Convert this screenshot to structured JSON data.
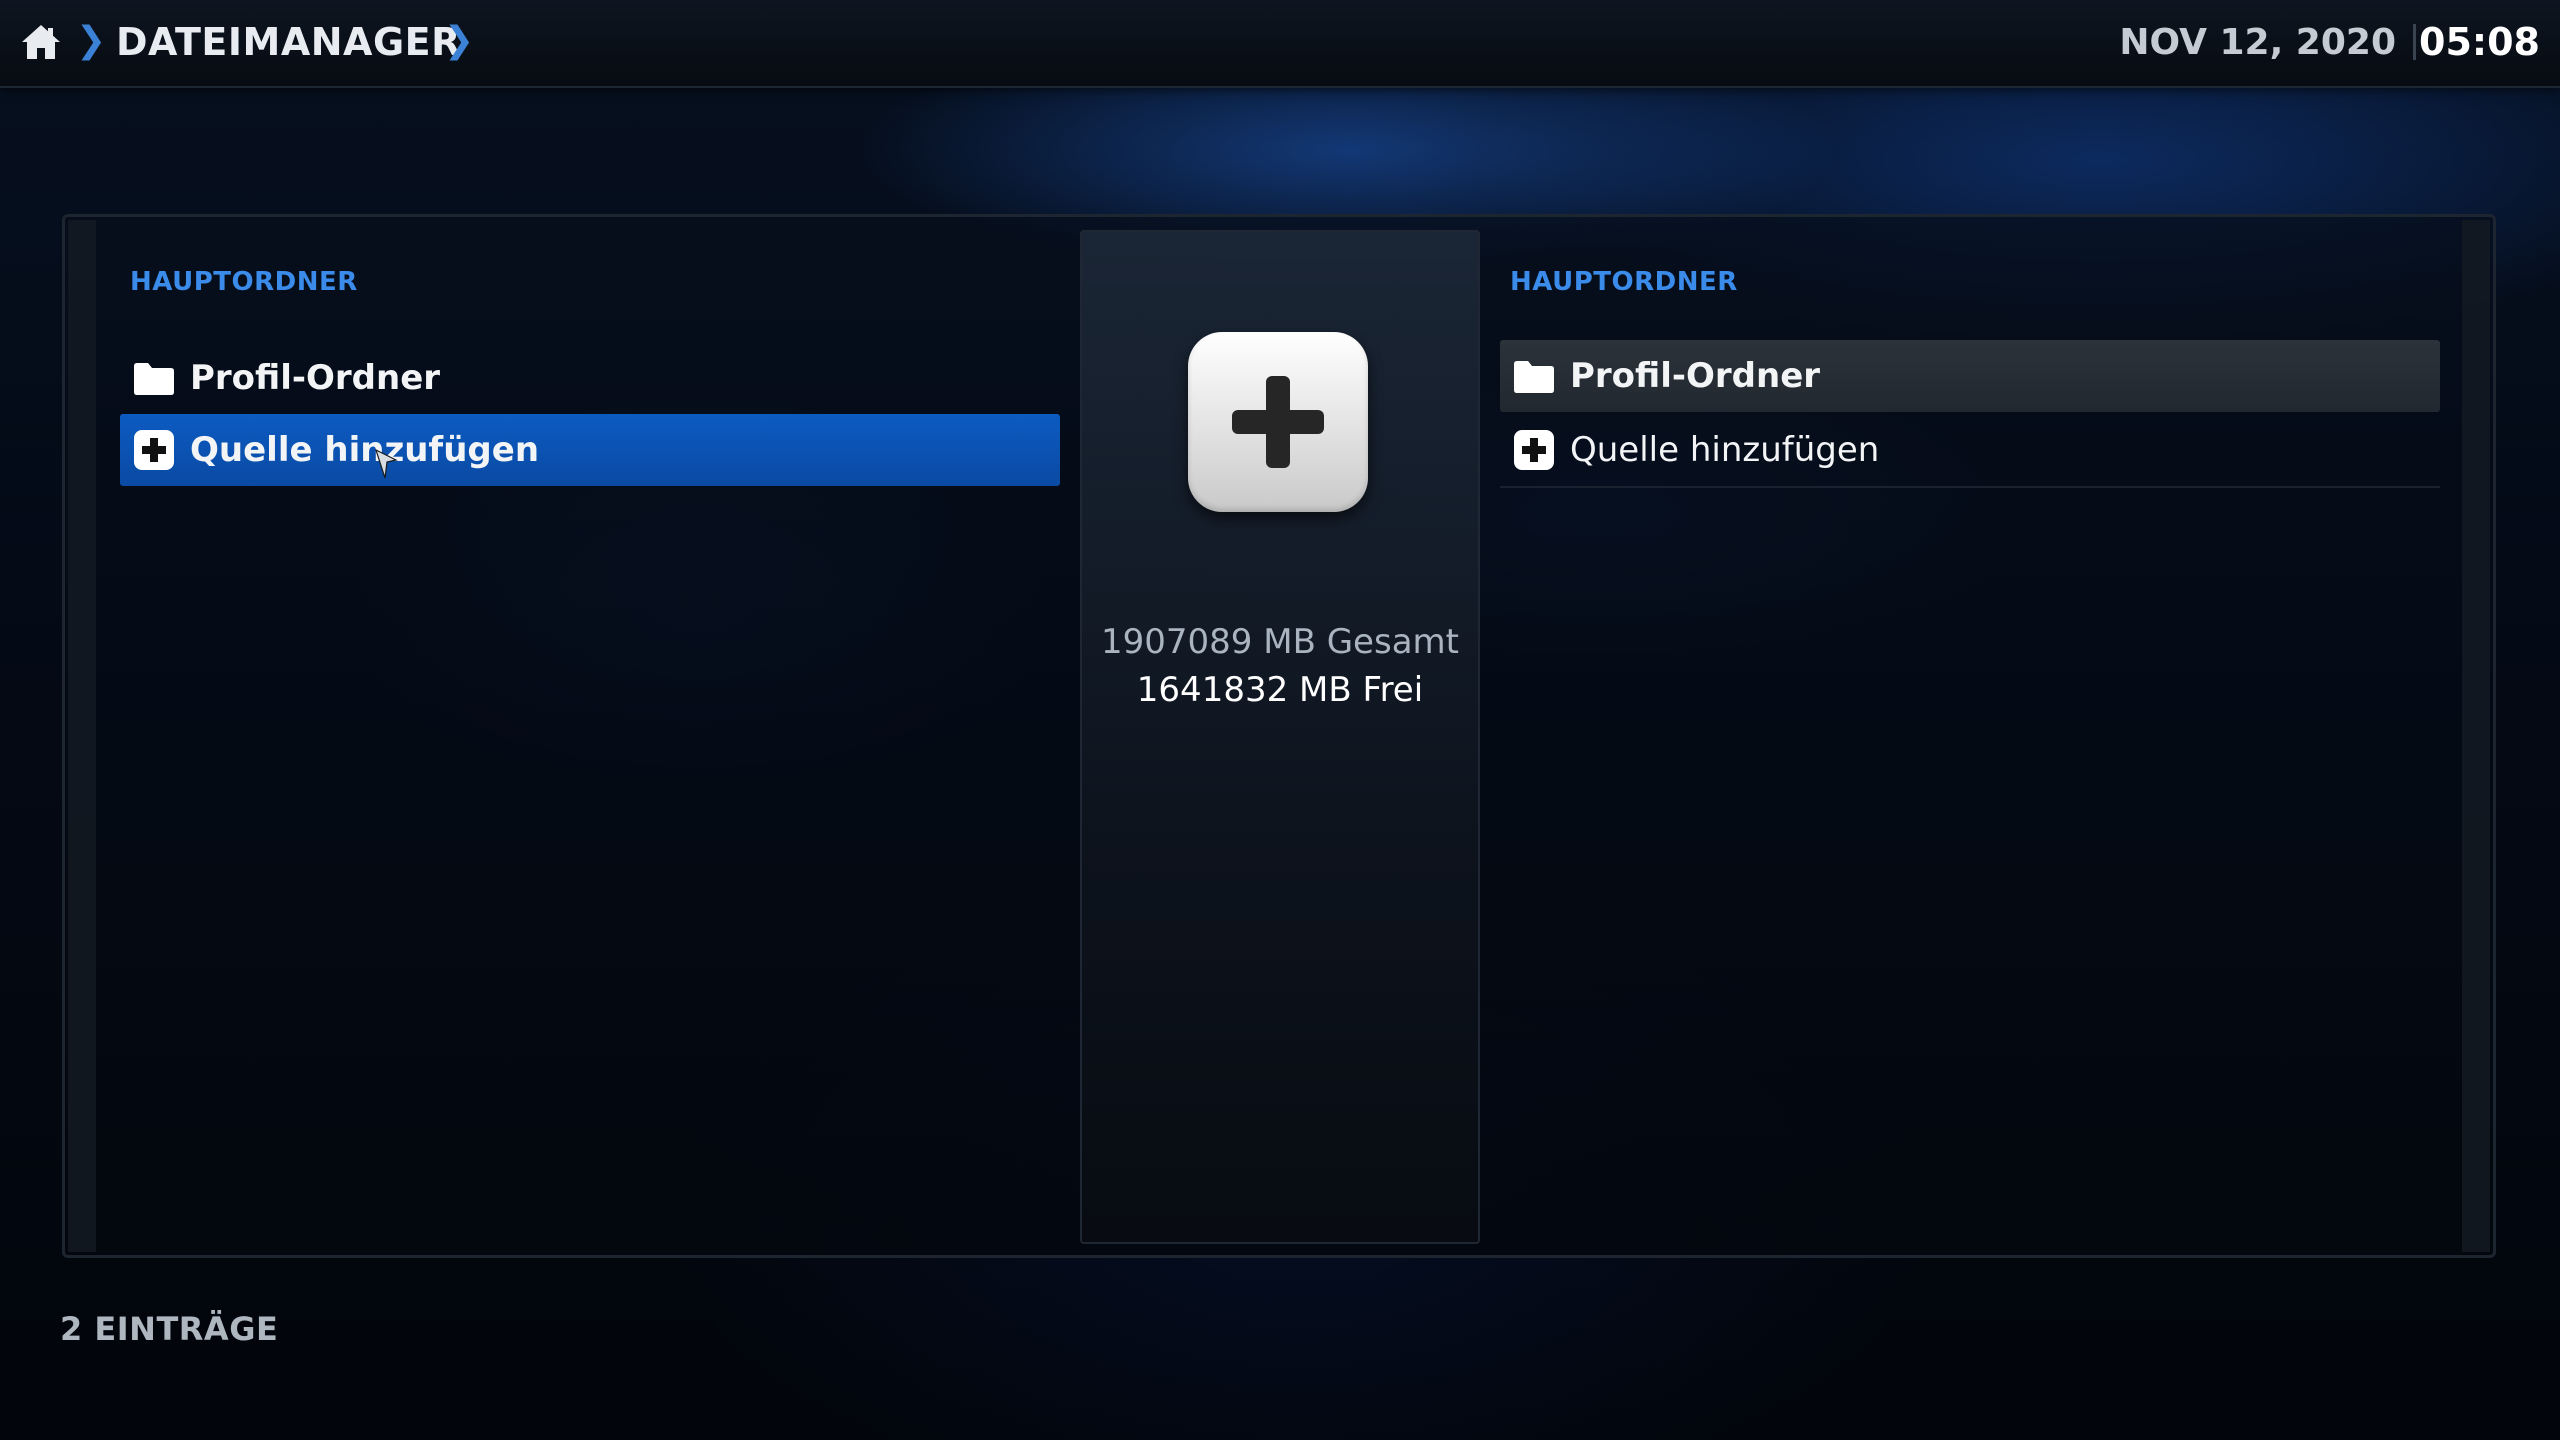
{
  "header": {
    "breadcrumb_title": "DATEIMANAGER",
    "breadcrumb_sep": "❯",
    "date": "NOV 12, 2020",
    "time": "05:08",
    "icons": {
      "home": "home-icon"
    }
  },
  "left_pane": {
    "header": "HAUPTORDNER",
    "items": [
      {
        "label": "Profil-Ordner",
        "icon": "folder-icon"
      },
      {
        "label": "Quelle hinzufügen",
        "icon": "add-source-icon",
        "state": "selected"
      }
    ]
  },
  "center_panel": {
    "icon": "add-icon",
    "total": "1907089 MB Gesamt",
    "free": "1641832 MB Frei"
  },
  "right_pane": {
    "header": "HAUPTORDNER",
    "items": [
      {
        "label": "Profil-Ordner",
        "icon": "folder-icon",
        "state": "focused"
      },
      {
        "label": "Quelle hinzufügen",
        "icon": "add-source-icon"
      }
    ]
  },
  "footer": {
    "count": "2 EINTRÄGE"
  },
  "colors": {
    "accent": "#3a8bea",
    "selected": "#0c5bc2",
    "focused": "#2b323a"
  }
}
